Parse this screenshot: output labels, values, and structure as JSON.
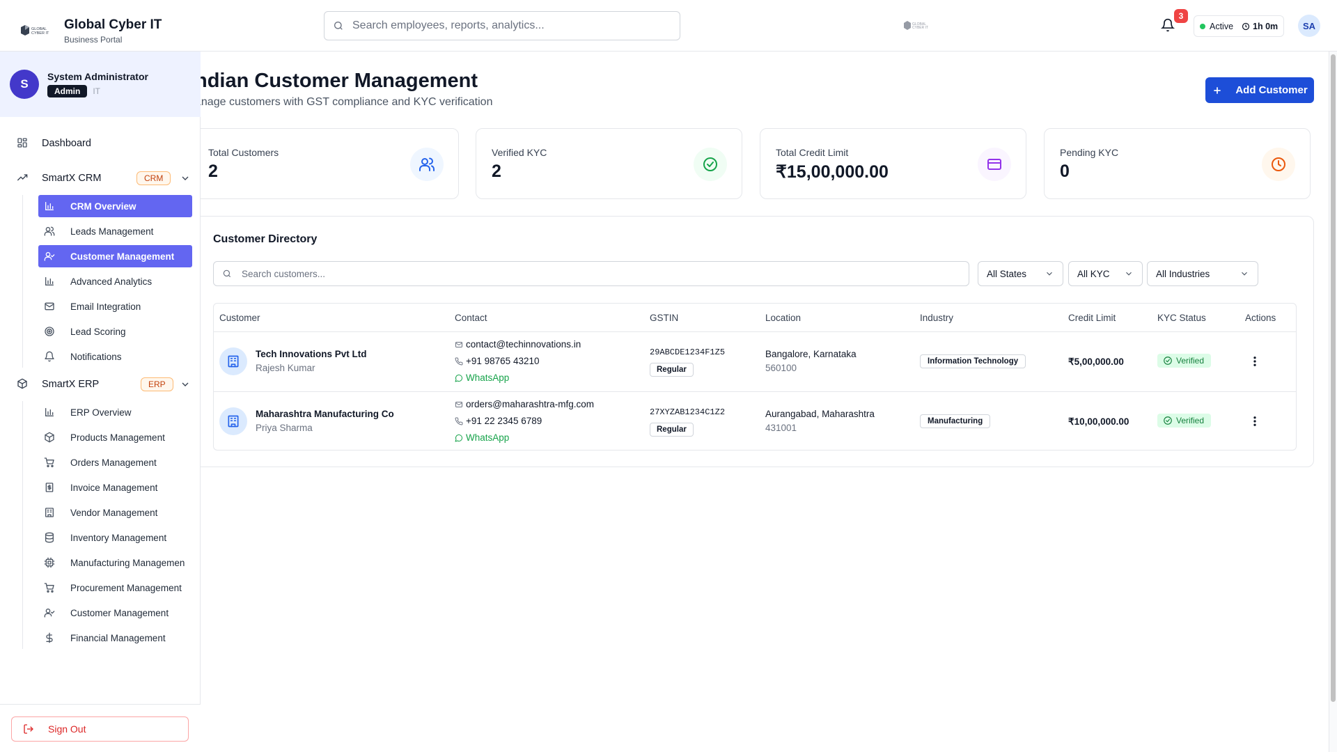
{
  "header": {
    "brand_name": "Global Cyber IT",
    "brand_sub": "Business Portal",
    "logo_icon": "global-cyber-it-logo",
    "search_placeholder": "Search employees, reports, analytics...",
    "notifications_count": "3",
    "status_label": "Active",
    "session_time": "1h 0m",
    "user_initials": "SA"
  },
  "sidebar": {
    "profile": {
      "initial": "S",
      "name": "System Administrator",
      "role": "Admin",
      "department": "IT"
    },
    "dashboard_label": "Dashboard",
    "crm": {
      "label": "SmartX CRM",
      "badge": "CRM",
      "items": [
        {
          "label": "CRM Overview",
          "icon": "bar-chart-icon",
          "active": true
        },
        {
          "label": "Leads Management",
          "icon": "users-icon",
          "active": false
        },
        {
          "label": "Customer Management",
          "icon": "user-check-icon",
          "active": true
        },
        {
          "label": "Advanced Analytics",
          "icon": "bar-chart-icon",
          "active": false
        },
        {
          "label": "Email Integration",
          "icon": "mail-icon",
          "active": false
        },
        {
          "label": "Lead Scoring",
          "icon": "target-icon",
          "active": false
        },
        {
          "label": "Notifications",
          "icon": "bell-icon",
          "active": false
        }
      ]
    },
    "erp": {
      "label": "SmartX ERP",
      "badge": "ERP",
      "items": [
        {
          "label": "ERP Overview",
          "icon": "bar-chart-icon"
        },
        {
          "label": "Products Management",
          "icon": "package-icon"
        },
        {
          "label": "Orders Management",
          "icon": "cart-icon"
        },
        {
          "label": "Invoice Management",
          "icon": "receipt-icon"
        },
        {
          "label": "Vendor Management",
          "icon": "building-icon"
        },
        {
          "label": "Inventory Management",
          "icon": "database-icon"
        },
        {
          "label": "Manufacturing Managemen",
          "icon": "cpu-icon"
        },
        {
          "label": "Procurement Management",
          "icon": "cart-icon"
        },
        {
          "label": "Customer Management",
          "icon": "user-check-icon"
        },
        {
          "label": "Financial Management",
          "icon": "dollar-icon"
        }
      ]
    },
    "sign_out": "Sign Out"
  },
  "main": {
    "title": "ndian Customer Management",
    "subtitle": "anage customers with GST compliance and KYC verification",
    "add_button": "Add Customer",
    "stats": [
      {
        "label": "Total Customers",
        "value": "2",
        "icon": "users-icon",
        "color": "#2563eb",
        "bg": "#eff6ff"
      },
      {
        "label": "Verified KYC",
        "value": "2",
        "icon": "check-circle-icon",
        "color": "#16a34a",
        "bg": "#f0fdf4"
      },
      {
        "label": "Total Credit Limit",
        "value": "₹15,00,000.00",
        "icon": "credit-card-icon",
        "color": "#9333ea",
        "bg": "#faf5ff"
      },
      {
        "label": "Pending KYC",
        "value": "0",
        "icon": "clock-icon",
        "color": "#ea580c",
        "bg": "#fff7ed"
      }
    ],
    "directory": {
      "title": "Customer Directory",
      "search_placeholder": "Search customers...",
      "filters": [
        "All States",
        "All KYC",
        "All Industries"
      ],
      "columns": [
        "Customer",
        "Contact",
        "GSTIN",
        "Location",
        "Industry",
        "Credit Limit",
        "KYC Status",
        "Actions"
      ],
      "rows": [
        {
          "name": "Tech Innovations Pvt Ltd",
          "person": "Rajesh Kumar",
          "email": "contact@techinnovations.in",
          "phone": "+91 98765 43210",
          "whatsapp": "WhatsApp",
          "gstin": "29ABCDE1234F1Z5",
          "gst_type": "Regular",
          "city": "Bangalore, Karnataka",
          "pin": "560100",
          "industry": "Information Technology",
          "credit": "₹5,00,000.00",
          "kyc": "Verified"
        },
        {
          "name": "Maharashtra Manufacturing Co",
          "person": "Priya Sharma",
          "email": "orders@maharashtra-mfg.com",
          "phone": "+91 22 2345 6789",
          "whatsapp": "WhatsApp",
          "gstin": "27XYZAB1234C1Z2",
          "gst_type": "Regular",
          "city": "Aurangabad, Maharashtra",
          "pin": "431001",
          "industry": "Manufacturing",
          "credit": "₹10,00,000.00",
          "kyc": "Verified"
        }
      ]
    }
  }
}
